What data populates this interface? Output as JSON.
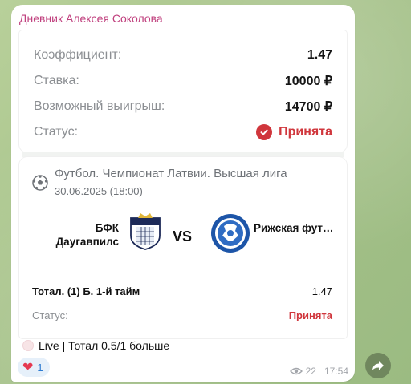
{
  "channel": {
    "author": "Дневник Алексея Соколова"
  },
  "summary": {
    "rows": [
      {
        "label": "Коэффициент:",
        "value": "1.47"
      },
      {
        "label": "Ставка:",
        "value": "10000 ₽"
      },
      {
        "label": "Возможный выигрыш:",
        "value": "14700 ₽"
      }
    ],
    "status_label": "Статус:",
    "status_value": "Принята",
    "status_icon": "check-circle-icon"
  },
  "event": {
    "league": "Футбол. Чемпионат Латвии. Высшая лига",
    "datetime": "30.06.2025 (18:00)",
    "sport_icon": "football-icon",
    "team_home": "БФК Даугавпилс",
    "team_away": "Рижская футбольная ...",
    "vs": "VS",
    "bet_label": "Тотал. (1) Б. 1-й тайм",
    "bet_odds": "1.47",
    "status_label": "Статус:",
    "status_value": "Принята"
  },
  "message": {
    "caption": "Live | Тотал 0.5/1 больше",
    "reaction_emoji": "❤",
    "reaction_count": "1",
    "views": "22",
    "time": "17:54"
  },
  "colors": {
    "accent": "#d0363c",
    "author": "#c0407e",
    "reaction": "#2d7bd1"
  }
}
